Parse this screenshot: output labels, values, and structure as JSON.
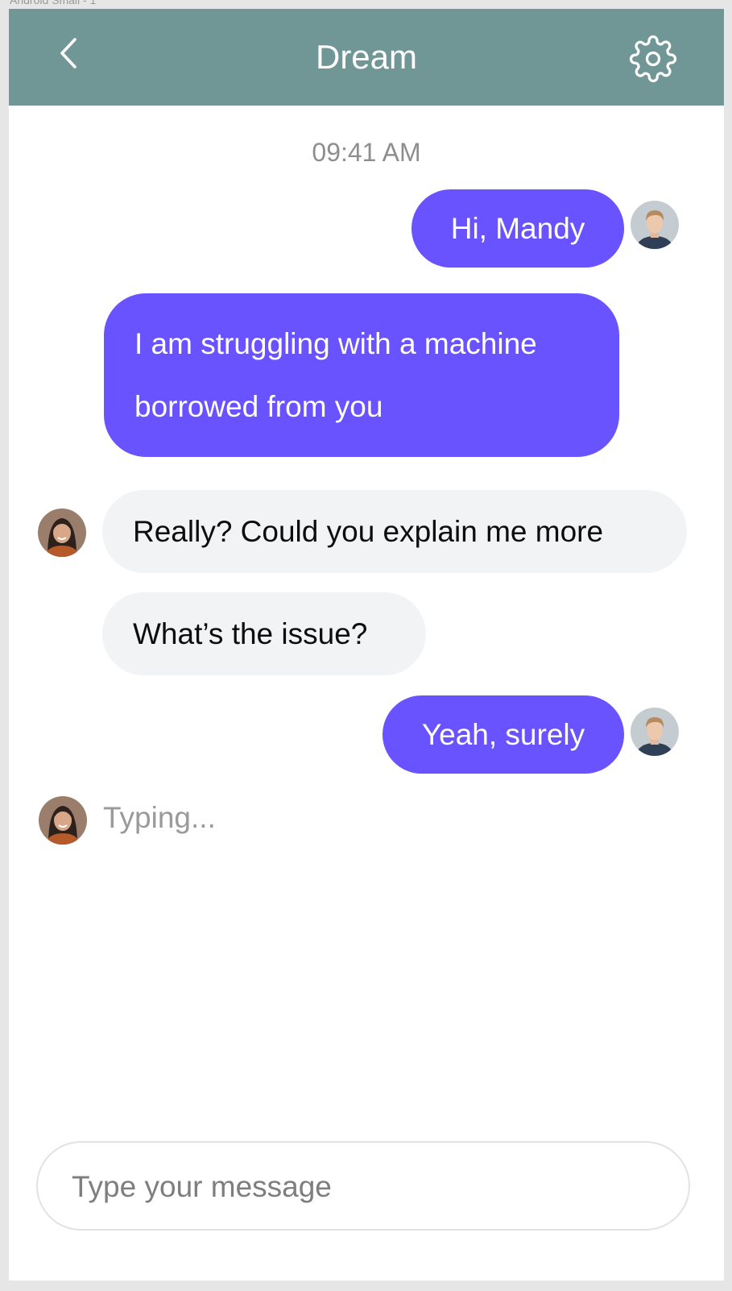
{
  "frame": {
    "label": "Android Small - 1"
  },
  "header": {
    "title": "Dream",
    "back_icon": "chevron-left-icon",
    "settings_icon": "gear-icon",
    "color": "#709696"
  },
  "chat": {
    "timestamp": "09:41 AM",
    "messages": [
      {
        "from": "me",
        "text": "Hi, Mandy"
      },
      {
        "from": "me",
        "text": "I am struggling with a machine\nborrowed from you"
      },
      {
        "from": "them",
        "text": "Really? Could you explain me more"
      },
      {
        "from": "them",
        "text": "What’s the issue?"
      },
      {
        "from": "me",
        "text": "Yeah, surely"
      }
    ],
    "typing": "Typing...",
    "outgoing_color": "#6952ff",
    "incoming_color": "#f2f3f5"
  },
  "composer": {
    "placeholder": "Type your message"
  }
}
